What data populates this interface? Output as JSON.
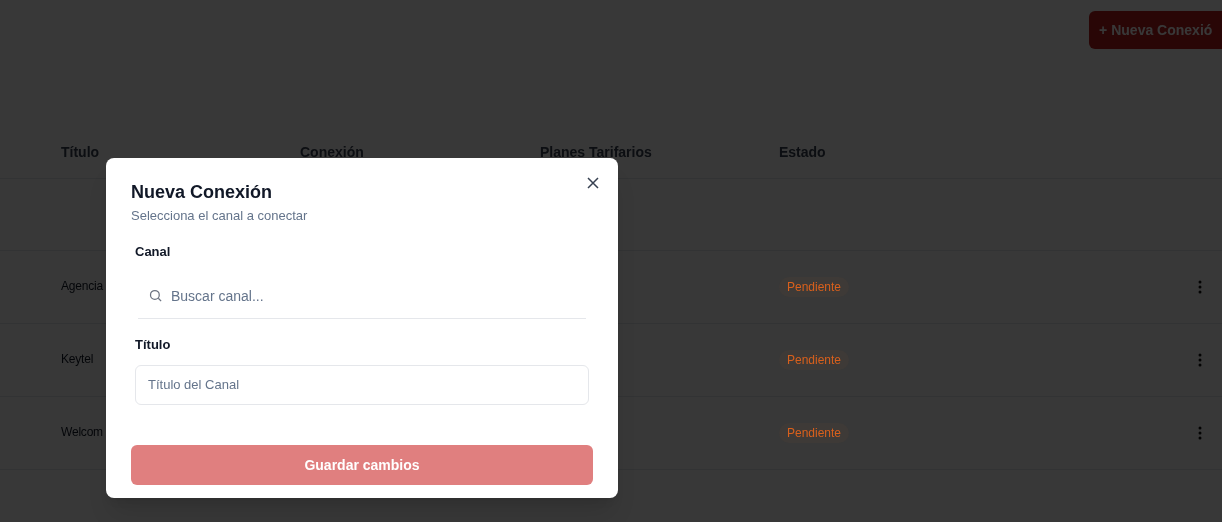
{
  "header": {
    "new_button": {
      "icon": "+",
      "label": "Nueva Conexió"
    }
  },
  "table": {
    "columns": [
      "Título",
      "Conexión",
      "Planes Tarifarios",
      "Estado"
    ],
    "rows": [
      {
        "title": "Agencia",
        "status": "Pendiente"
      },
      {
        "title": "Keytel",
        "status": "Pendiente"
      },
      {
        "title": "Welcom",
        "status": "Pendiente"
      }
    ]
  },
  "dialog": {
    "title": "Nueva Conexión",
    "subtitle": "Selecciona el canal a conectar",
    "canal_label": "Canal",
    "search": {
      "placeholder": "Buscar canal..."
    },
    "titulo_label": "Título",
    "titulo_field": {
      "placeholder": "Título del Canal"
    },
    "save_button": {
      "label": "Guardar cambios",
      "disabled": true
    }
  }
}
